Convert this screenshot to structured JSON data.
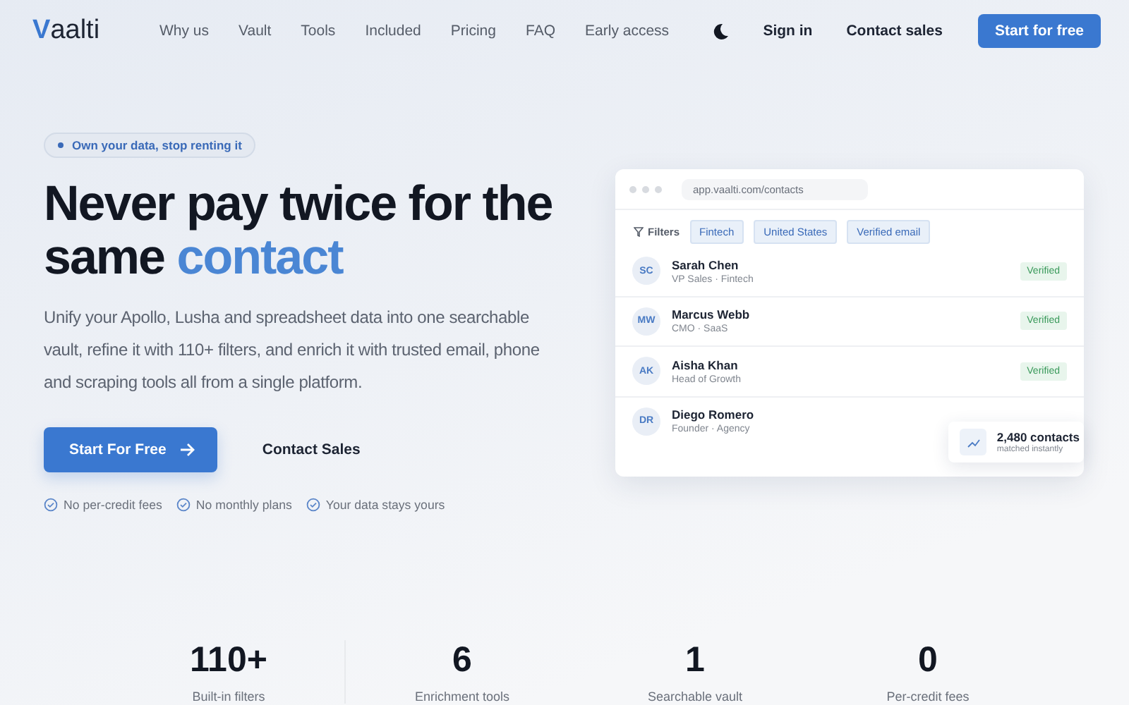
{
  "nav": {
    "logo_mark": "V",
    "logo_text": "aalti",
    "links": [
      "Why us",
      "Vault",
      "Tools",
      "Included",
      "Pricing",
      "FAQ",
      "Early access"
    ],
    "sign_in": "Sign in",
    "contact": "Contact sales",
    "cta": "Start for free"
  },
  "hero": {
    "badge": "Own your data, stop renting it",
    "title_line1": "Never pay twice for the",
    "title_line2_plain": "same",
    "title_line2_accent": "contact",
    "lead": "Unify your Apollo, Lusha and spreadsheet data into one searchable vault, refine it with 110+ filters, and enrich it with trusted email, phone and scraping tools all from a single platform.",
    "primary": "Start For Free",
    "secondary": "Contact Sales",
    "perks": [
      "No per-credit fees",
      "No monthly plans",
      "Your data stays yours"
    ]
  },
  "mockup": {
    "url": "app.vaalti.com/contacts",
    "filters_label": "Filters",
    "filters": [
      "Fintech",
      "United States",
      "Verified email"
    ],
    "contacts": [
      {
        "initials": "SC",
        "name": "Sarah Chen",
        "role": "VP Sales · Fintech",
        "status": "Verified"
      },
      {
        "initials": "MW",
        "name": "Marcus Webb",
        "role": "CMO · SaaS",
        "status": "Verified"
      },
      {
        "initials": "AK",
        "name": "Aisha Khan",
        "role": "Head of Growth",
        "status": "Verified"
      },
      {
        "initials": "DR",
        "name": "Diego Romero",
        "role": "Founder · Agency"
      }
    ],
    "toast_title": "2,480 contacts",
    "toast_sub": "matched instantly"
  },
  "stats": [
    {
      "value": "110+",
      "label": "Built-in filters"
    },
    {
      "value": "6",
      "label": "Enrichment tools"
    },
    {
      "value": "1",
      "label": "Searchable vault"
    },
    {
      "value": "0",
      "label": "Per-credit fees"
    }
  ]
}
